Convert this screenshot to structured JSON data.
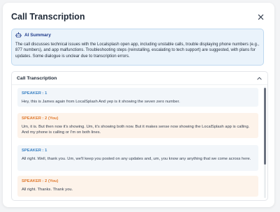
{
  "modal": {
    "title": "Call Transcription"
  },
  "summary": {
    "heading": "AI Summary",
    "text": "The call discusses technical issues with the Localsplash open app, including unstable calls, trouble displaying phone numbers (e.g., 877 numbers), and app malfunctions. Troubleshooting steps (reinstalling, escalating to tech support) are suggested, with plans for updates. Some dialogue is unclear due to transcription errors."
  },
  "transcript": {
    "heading": "Call Transcription",
    "messages": [
      {
        "speaker": "SPEAKER : 1",
        "text": "Hey, this is James again from LocalSplash And yep is it showing the seven zero number."
      },
      {
        "speaker": "SPEAKER : 2 (You)",
        "text": "Um, it is. But then now it's showing. Um, it's showing both now. But it makes sense now showing the LocalSplash app is calling. And my phone is calling or I'm on both lines."
      },
      {
        "speaker": "SPEAKER : 1",
        "text": "All right. Well, thank you. Um, we'll keep you posted on any updates and, um, you know any anything that we come across here."
      },
      {
        "speaker": "SPEAKER : 2 (You)",
        "text": "All right. Thanks. Thank you."
      }
    ],
    "scroll_position": 0.0
  },
  "colors": {
    "speaker1": "#3b82c4",
    "speaker2": "#e07a2e",
    "summary_bg": "#eaf3fb"
  },
  "icons": {
    "close": "close-icon",
    "robot": "robot-icon",
    "collapse": "chevron-up-icon"
  }
}
